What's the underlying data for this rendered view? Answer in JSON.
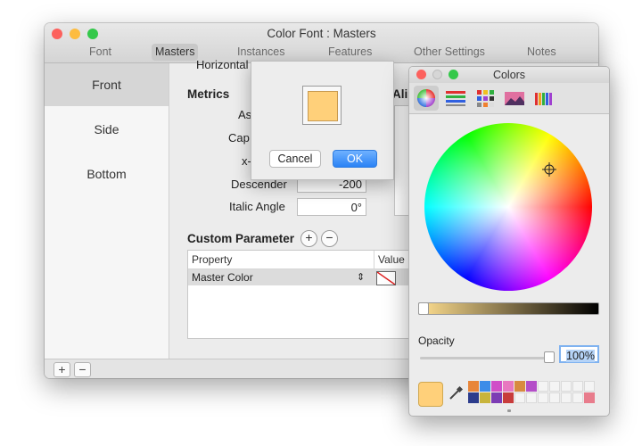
{
  "window": {
    "title": "Color Font : Masters",
    "tabs": [
      "Font",
      "Masters",
      "Instances",
      "Features",
      "Other Settings",
      "Notes"
    ],
    "selected_tab": "Masters"
  },
  "sidebar": {
    "items": [
      {
        "label": "Front",
        "selected": true
      },
      {
        "label": "Side",
        "selected": false
      },
      {
        "label": "Bottom",
        "selected": false
      }
    ],
    "add_label": "+",
    "remove_label": "−"
  },
  "main": {
    "horizontal_label": "Horizontal",
    "metrics_heading": "Metrics",
    "alignment_heading_partial": "Ali",
    "metrics": {
      "ascender_label": "As",
      "cap_label": "Cap",
      "x_label": "x-",
      "descender_label": "Descender",
      "descender_value": "-200",
      "italic_label": "Italic Angle",
      "italic_value": "0°"
    },
    "custom_param": {
      "heading": "Custom Parameter",
      "add": "+",
      "remove": "−",
      "col_property": "Property",
      "col_value": "Value",
      "row_property": "Master Color",
      "row_stepper": "⇕"
    }
  },
  "popover": {
    "swatch_color": "#ffd07a",
    "cancel_label": "Cancel",
    "ok_label": "OK"
  },
  "colors_panel": {
    "title": "Colors",
    "tools": [
      "color-wheel",
      "color-sliders",
      "color-palettes",
      "image-palettes",
      "crayons"
    ],
    "selected_tool": "color-wheel",
    "brightness": 0.98,
    "opacity_label": "Opacity",
    "opacity_value": "100%",
    "current_color": "#ffd07a",
    "swatches_row1": [
      "#e8863a",
      "#3c8ce8",
      "#d04ec8",
      "#e878c0",
      "#d88a40",
      "#b44ec8",
      "",
      "",
      "",
      "",
      ""
    ],
    "swatches_row2": [
      "#2c3c8c",
      "#c8b43c",
      "#7c3cb4",
      "#c83c3c",
      "",
      "",
      "",
      "",
      "",
      "",
      "#e87c8c"
    ]
  }
}
